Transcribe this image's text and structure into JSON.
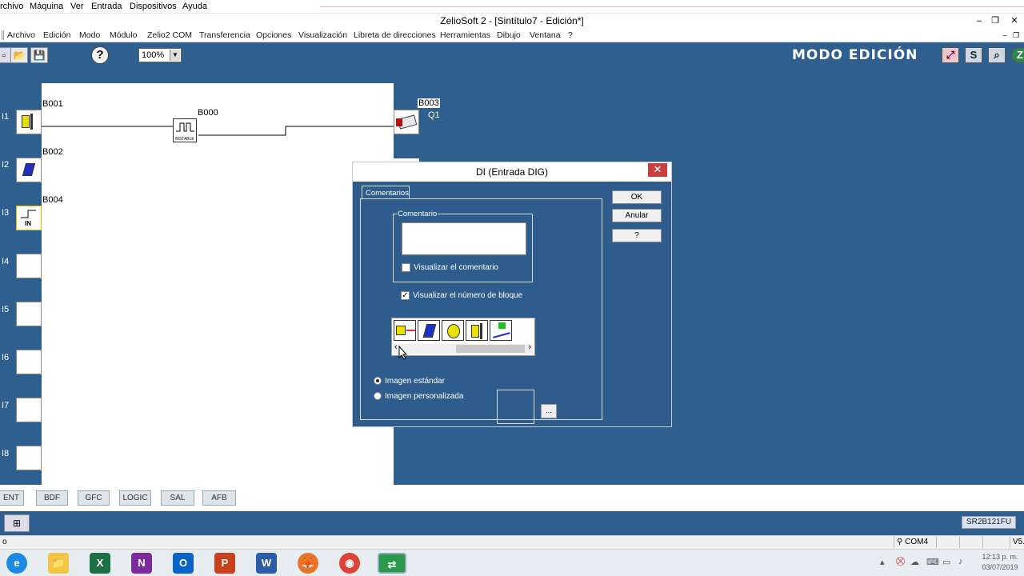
{
  "outer_menu": [
    "rchivo",
    "Máquina",
    "Ver",
    "Entrada",
    "Dispositivos",
    "Ayuda"
  ],
  "window": {
    "title": "ZelioSoft 2 - [Sintítulo7 - Edición*]",
    "minimize": "–",
    "restore": "❐",
    "close": "✕"
  },
  "app_menu": [
    "Archivo",
    "Edición",
    "Modo",
    "Módulo",
    "Zelio2 COM",
    "Transferencia",
    "Opciones",
    "Visualización",
    "Libreta de direcciones",
    "Herramientas",
    "Dibujo",
    "Ventana",
    "?"
  ],
  "toolbar": {
    "zoom": "100%",
    "help": "?",
    "mode_text": "MODO EDICIÓN",
    "s_button": "S"
  },
  "diagram": {
    "rows": [
      "I1",
      "I2",
      "I3",
      "I4",
      "I5",
      "I6",
      "I7",
      "I8"
    ],
    "blocks": {
      "b001": "B001",
      "b002": "B002",
      "b004": "B004",
      "b000": "B000",
      "b003": "B003",
      "q1": "Q1",
      "in_icon": "IN",
      "bistable_icon": "BISTABLE"
    }
  },
  "dialog": {
    "title": "DI (Entrada DIG)",
    "close": "✕",
    "tab": "Comentarios",
    "ok": "OK",
    "cancel": "Anular",
    "help": "?",
    "group_label": "Comentario",
    "comment_value": "",
    "show_comment": "Visualizar el comentario",
    "show_comment_checked": false,
    "show_block_number": "Visualizar el número de bloque",
    "show_block_number_checked": true,
    "standard_image": "Imagen estándar",
    "custom_image": "Imagen personalizada",
    "selected_image_option": "standard",
    "browse": "...",
    "scroll_left": "‹",
    "scroll_right": "›"
  },
  "function_tabs": [
    "ENT",
    "BDF",
    "GFC",
    "LOGIC",
    "SAL",
    "AFB"
  ],
  "status": {
    "model": "SR2B121FU",
    "port": "COM4",
    "version": "V5.",
    "left": "o"
  },
  "taskbar": {
    "apps": [
      "e",
      "📁",
      "X",
      "N",
      "O",
      "P",
      "W",
      "🦊",
      "◉",
      "⇄"
    ],
    "time": "12:13 p. m.",
    "date": "03/07/2019"
  }
}
